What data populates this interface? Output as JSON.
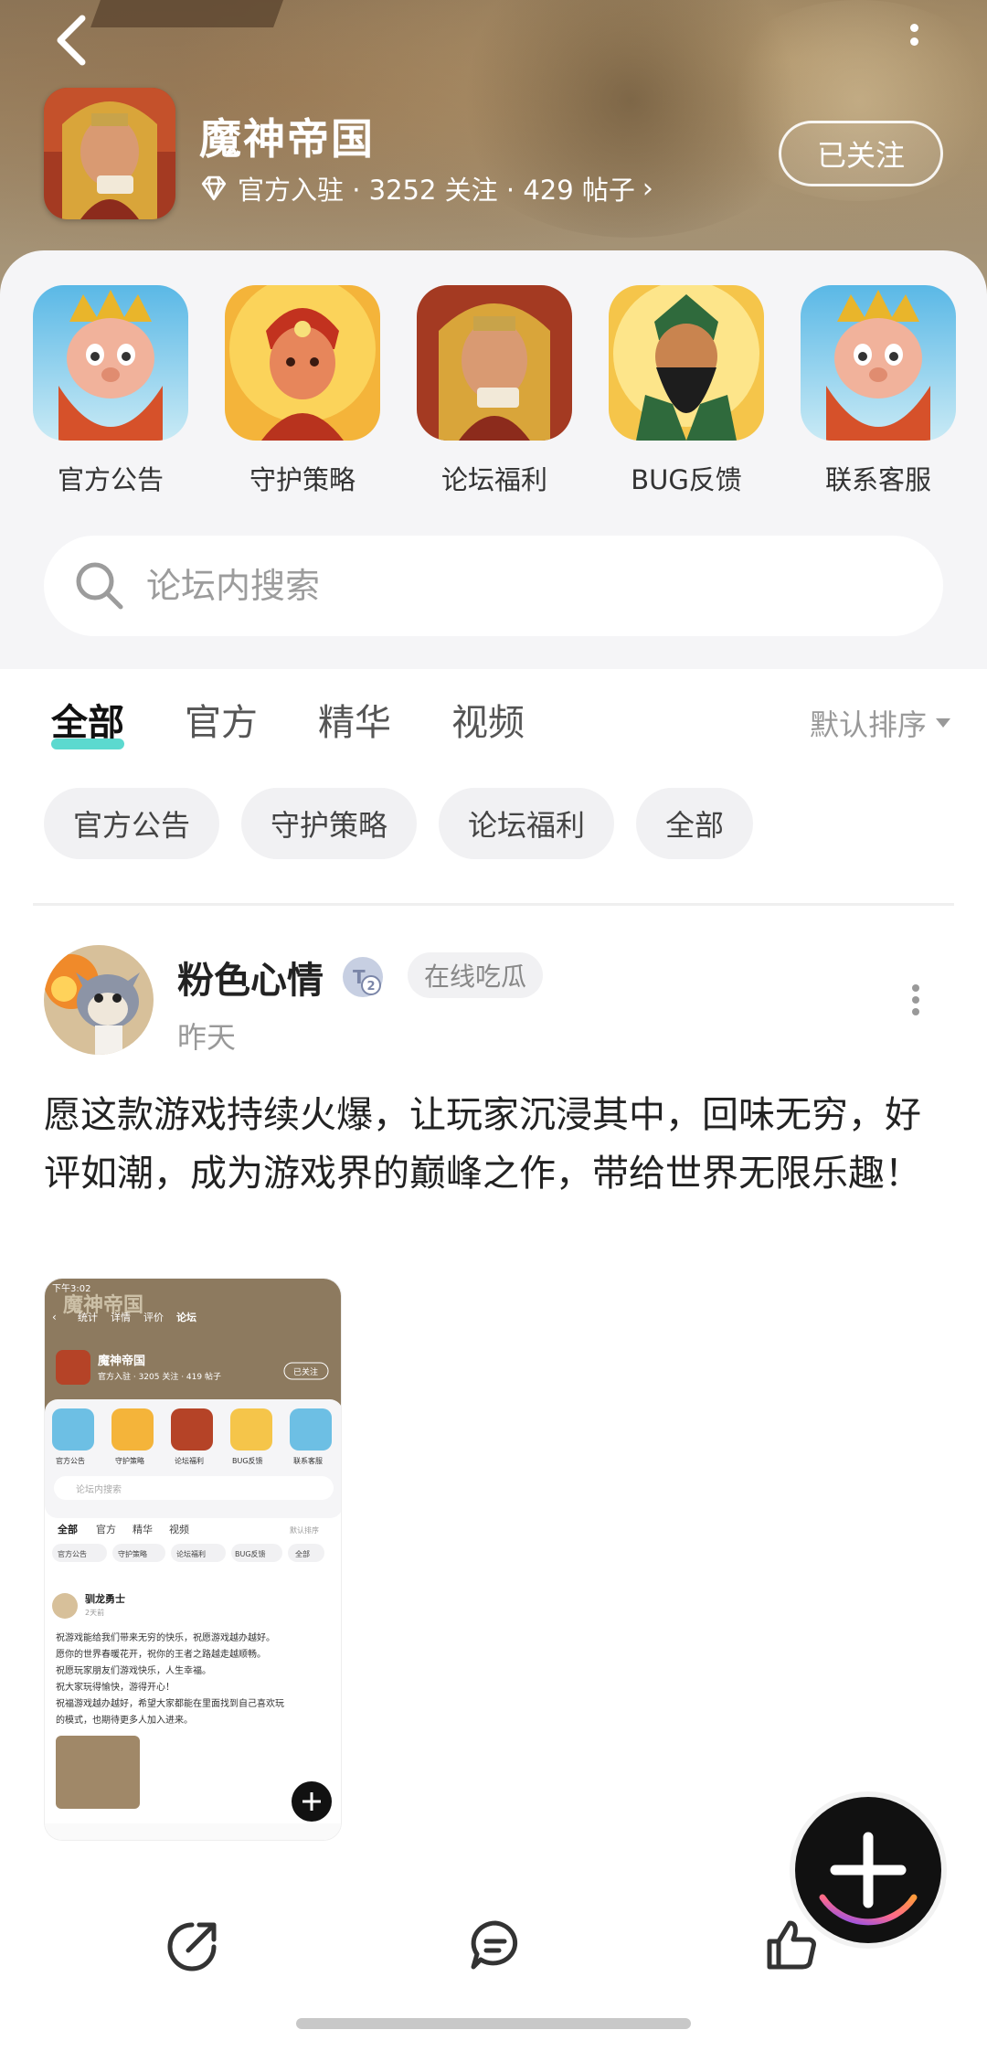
{
  "header": {
    "title": "魔神帝国",
    "meta": "官方入驻 · 3252 关注 · 429 帖子",
    "follow_label": "已关注"
  },
  "shortcuts": [
    {
      "label": "官方公告",
      "icon": "king-avatar"
    },
    {
      "label": "守护策略",
      "icon": "flame-hero-avatar"
    },
    {
      "label": "论坛福利",
      "icon": "golden-hero-avatar"
    },
    {
      "label": "BUG反馈",
      "icon": "bearded-general-avatar"
    },
    {
      "label": "联系客服",
      "icon": "king-avatar"
    }
  ],
  "search": {
    "placeholder": "论坛内搜索"
  },
  "tabs": [
    {
      "label": "全部",
      "active": true
    },
    {
      "label": "官方",
      "active": false
    },
    {
      "label": "精华",
      "active": false
    },
    {
      "label": "视频",
      "active": false
    }
  ],
  "sort_label": "默认排序",
  "chips": [
    "官方公告",
    "守护策略",
    "论坛福利",
    "全部"
  ],
  "post": {
    "author": "粉色心情",
    "badge": "在线吃瓜",
    "time": "昨天",
    "text": "愿这款游戏持续火爆，让玩家沉浸其中，回味无穷，好评如潮，成为游戏界的巅峰之作，带给世界无限乐趣！",
    "image": {
      "status_time": "下午3:02",
      "banner": "魔神帝国",
      "tabs": [
        "统计",
        "详情",
        "评价",
        "论坛"
      ],
      "title": "魔神帝国",
      "meta": "官方入驻 · 3205 关注 · 419 帖子",
      "follow": "已关注",
      "shortcuts": [
        "官方公告",
        "守护策略",
        "论坛福利",
        "BUG反馈",
        "联系客服"
      ],
      "search": "论坛内搜索",
      "feed_tabs": [
        "全部",
        "官方",
        "精华",
        "视频"
      ],
      "sort": "默认排序",
      "chips": [
        "官方公告",
        "守护策略",
        "论坛福利",
        "BUG反馈",
        "全部"
      ],
      "author": "驯龙勇士",
      "time": "2天前",
      "lines": [
        "祝游戏能给我们带来无穷的快乐，祝愿游戏越办越好。",
        "愿你的世界春暖花开，祝你的王者之路越走越顺畅。",
        "祝愿玩家朋友们游戏快乐，人生幸福。",
        "祝大家玩得愉快，游得开心！",
        "祝福游戏越办越好，希望大家都能在里面找到自己喜欢玩",
        "的模式，也期待更多人加入进来。"
      ]
    }
  },
  "colors": {
    "accent": "#3fd2c7",
    "card_bg": "#f5f5f7",
    "chip_bg": "#f1f1f3"
  }
}
